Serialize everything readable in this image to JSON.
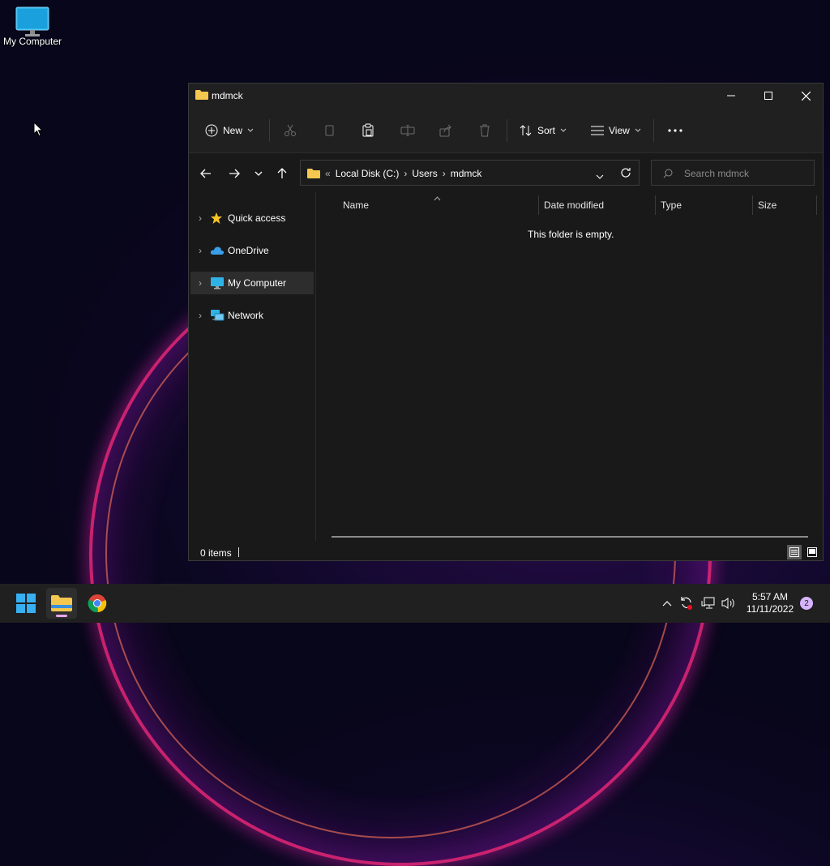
{
  "desktop": {
    "icons": [
      {
        "label": "My Computer",
        "icon": "monitor-icon"
      }
    ]
  },
  "window": {
    "title": "mdmck",
    "toolbar": {
      "new_label": "New",
      "sort_label": "Sort",
      "view_label": "View"
    },
    "address": {
      "overflow": "«",
      "crumbs": [
        "Local Disk (C:)",
        "Users",
        "mdmck"
      ]
    },
    "search": {
      "placeholder": "Search mdmck"
    },
    "nav_pane": {
      "items": [
        {
          "label": "Quick access",
          "icon": "star-icon"
        },
        {
          "label": "OneDrive",
          "icon": "cloud-icon"
        },
        {
          "label": "My Computer",
          "icon": "monitor-icon",
          "selected": true
        },
        {
          "label": "Network",
          "icon": "network-icon"
        }
      ]
    },
    "columns": [
      "Name",
      "Date modified",
      "Type",
      "Size"
    ],
    "empty_message": "This folder is empty.",
    "status": {
      "items_count": "0 items"
    }
  },
  "taskbar": {
    "clock": {
      "time": "5:57 AM",
      "date": "11/11/2022"
    },
    "notification_count": "2"
  },
  "colors": {
    "accent": "#0078d4",
    "folder": "#f4c74e",
    "window_bg": "#191919",
    "toolbar_bg": "#202020"
  }
}
